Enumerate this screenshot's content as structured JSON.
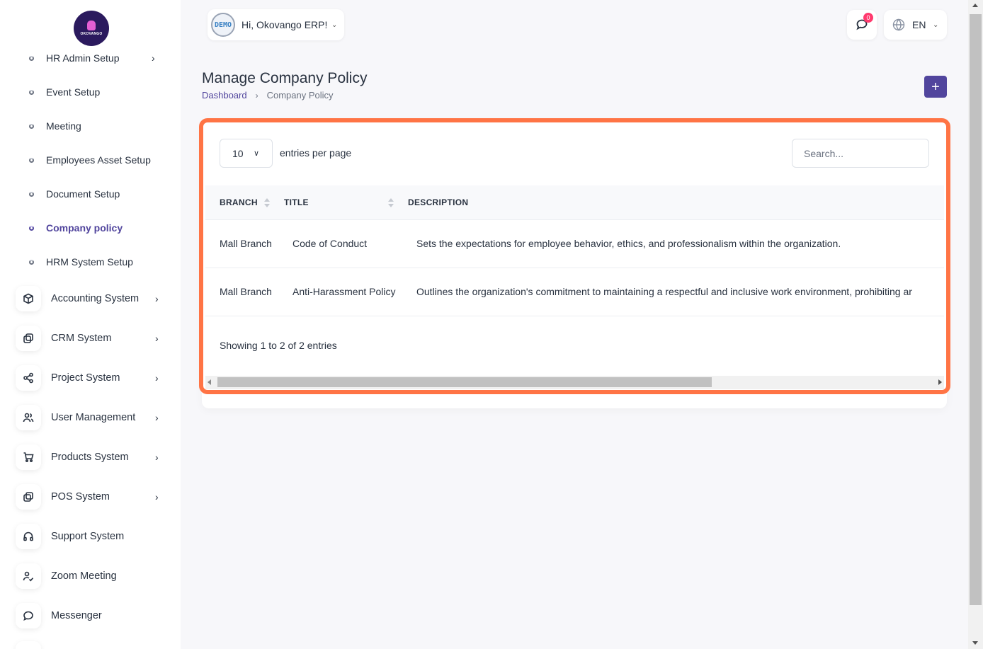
{
  "sidebar": {
    "logo_text": "OKOVANGO",
    "sub_items": [
      {
        "label": "HR Admin Setup",
        "has_chevron": true
      },
      {
        "label": "Event Setup"
      },
      {
        "label": "Meeting"
      },
      {
        "label": "Employees Asset Setup"
      },
      {
        "label": "Document Setup"
      },
      {
        "label": "Company policy",
        "active": true
      },
      {
        "label": "HRM System Setup"
      }
    ],
    "main_items": [
      {
        "label": "Accounting System",
        "icon": "box-icon",
        "has_chevron": true
      },
      {
        "label": "CRM System",
        "icon": "layers-icon",
        "has_chevron": true
      },
      {
        "label": "Project System",
        "icon": "share-icon",
        "has_chevron": true
      },
      {
        "label": "User Management",
        "icon": "users-icon",
        "has_chevron": true
      },
      {
        "label": "Products System",
        "icon": "cart-icon",
        "has_chevron": true
      },
      {
        "label": "POS System",
        "icon": "layers-icon",
        "has_chevron": true
      },
      {
        "label": "Support System",
        "icon": "headphones-icon"
      },
      {
        "label": "Zoom Meeting",
        "icon": "user-check-icon"
      },
      {
        "label": "Messenger",
        "icon": "message-icon"
      }
    ],
    "chevron": "›"
  },
  "header": {
    "avatar_text": "DEMO",
    "greeting": "Hi, Okovango ERP!",
    "notification_count": "0",
    "language": "EN"
  },
  "page": {
    "title": "Manage Company Policy",
    "breadcrumb": [
      "Dashboard",
      "Company Policy"
    ],
    "add_button": "+"
  },
  "table": {
    "per_page_value": "10",
    "per_page_label": "entries per page",
    "search_placeholder": "Search...",
    "columns": [
      "BRANCH",
      "TITLE",
      "DESCRIPTION"
    ],
    "rows": [
      {
        "branch": "Mall Branch",
        "title": "Code of Conduct",
        "description": "Sets the expectations for employee behavior, ethics, and professionalism within the organization."
      },
      {
        "branch": "Mall Branch",
        "title": "Anti-Harassment Policy",
        "description": "Outlines the organization's commitment to maintaining a respectful and inclusive work environment, prohibiting ar"
      }
    ],
    "info": "Showing 1 to 2 of 2 entries"
  },
  "colors": {
    "accent": "#51459d",
    "highlight": "#ff7445",
    "badge": "#ff3a6e"
  }
}
